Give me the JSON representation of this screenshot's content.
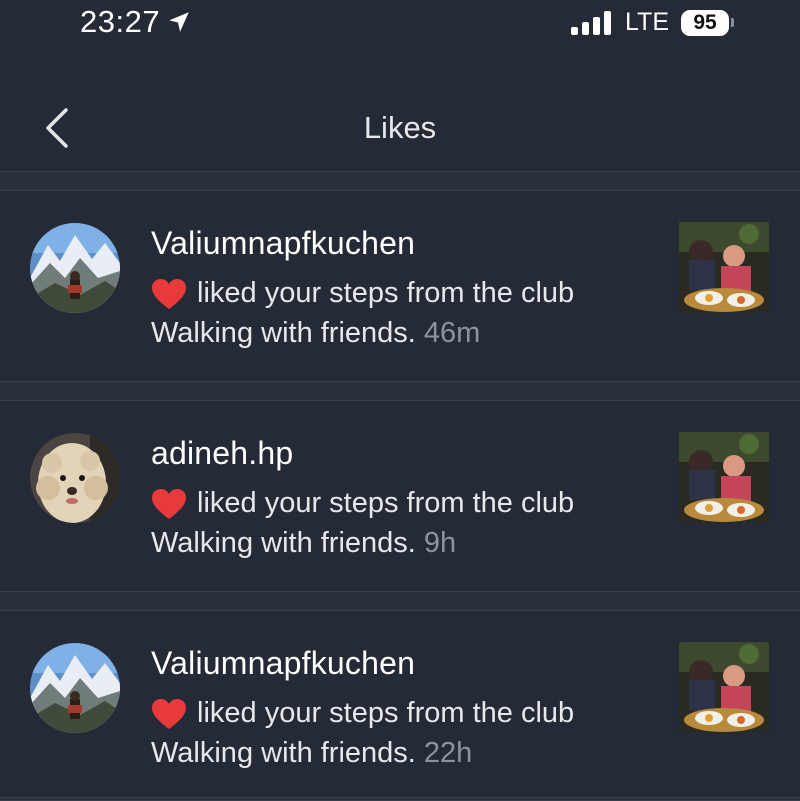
{
  "status_bar": {
    "time": "23:27",
    "network": "LTE",
    "battery": "95",
    "icons": [
      "location-arrow-icon",
      "signal-bars-icon",
      "battery-icon"
    ]
  },
  "header": {
    "title": "Likes",
    "back_icon": "chevron-left-icon"
  },
  "likes": [
    {
      "username": "Valiumnapfkuchen",
      "action": "liked your steps from the club",
      "club": "Walking with friends.",
      "time": "46m",
      "avatar": "mountain-photo",
      "thumbnail": "dinner-photo"
    },
    {
      "username": "adineh.hp",
      "action": "liked your steps from the club",
      "club": "Walking with friends.",
      "time": "9h",
      "avatar": "dog-photo",
      "thumbnail": "dinner-photo"
    },
    {
      "username": "Valiumnapfkuchen",
      "action": "liked your steps from the club",
      "club": "Walking with friends.",
      "time": "22h",
      "avatar": "mountain-photo",
      "thumbnail": "dinner-photo"
    }
  ],
  "colors": {
    "background": "#252b36",
    "divider": "#2b313c",
    "heart": "#e83a3a",
    "muted": "#8d929b"
  }
}
